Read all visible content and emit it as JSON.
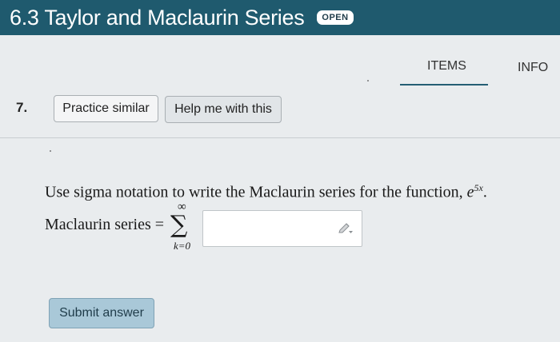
{
  "header": {
    "title": "6.3 Taylor and Maclaurin Series",
    "badge": "OPEN"
  },
  "tabs": {
    "items": "ITEMS",
    "info": "INFO"
  },
  "question": {
    "number": "7.",
    "practice_label": "Practice similar",
    "help_label": "Help me with this",
    "prompt": "Use sigma notation to write the Maclaurin series for the function, ",
    "function_base": "e",
    "function_exponent": "5x",
    "function_suffix": ".",
    "series_label": "Maclaurin series =",
    "sum_symbol": "∑",
    "sum_upper": "∞",
    "sum_lower": "k=0",
    "answer_value": ""
  },
  "actions": {
    "submit_label": "Submit answer"
  },
  "colors": {
    "header_bg": "#1f5a6e",
    "submit_bg": "#a9c8d8",
    "tab_underline": "#245e74"
  }
}
